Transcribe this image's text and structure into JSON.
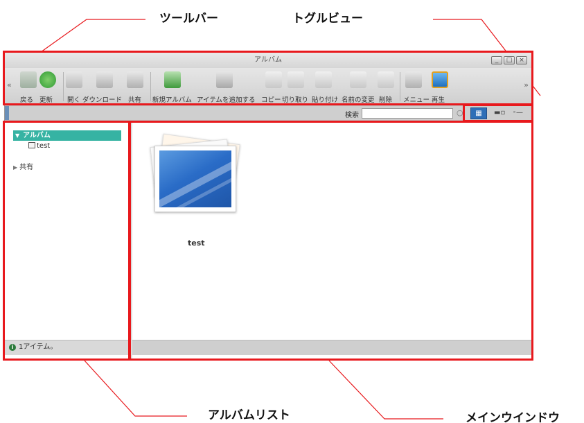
{
  "callouts": {
    "toolbar": "ツールバー",
    "toggle_view": "トグルビュー",
    "album_list": "アルバムリスト",
    "main_window": "メインウインドウ"
  },
  "window": {
    "title": "アルバム",
    "controls": [
      "_",
      "□",
      "×"
    ]
  },
  "toolbar": {
    "scroll_left": "«",
    "scroll_right": "»",
    "buttons": [
      {
        "label": "戻る",
        "icon": "back-arrow-icon"
      },
      {
        "label": "更新",
        "icon": "refresh-icon"
      },
      {
        "label": "開く",
        "icon": "open-folder-icon"
      },
      {
        "label": "ダウンロード",
        "icon": "download-icon"
      },
      {
        "label": "共有",
        "icon": "share-icon"
      },
      {
        "label": "新規アルバム",
        "icon": "new-album-icon"
      },
      {
        "label": "アイテムを追加する",
        "icon": "add-item-icon"
      },
      {
        "label": "コピー",
        "icon": "copy-icon"
      },
      {
        "label": "切り取り",
        "icon": "cut-icon"
      },
      {
        "label": "貼り付け",
        "icon": "paste-icon"
      },
      {
        "label": "名前の変更",
        "icon": "rename-icon"
      },
      {
        "label": "削除",
        "icon": "delete-icon"
      },
      {
        "label": "メニュー",
        "icon": "menu-icon"
      },
      {
        "label": "再生",
        "icon": "play-icon"
      }
    ]
  },
  "search": {
    "label": "検索",
    "value": "",
    "placeholder": ""
  },
  "view_toggle": {
    "grid_icon": "grid-view-icon",
    "list_icon": "list-view-icon",
    "detail_icon": "detail-view-icon"
  },
  "sidebar": {
    "album_root": "アルバム",
    "album_child": "test",
    "shared": "共有",
    "status": "1アイテム。"
  },
  "main": {
    "album_name": "test"
  },
  "colors": {
    "highlight": "#e8191d",
    "album_selected": "#36b3a3",
    "view_active": "#2f6fb7"
  }
}
